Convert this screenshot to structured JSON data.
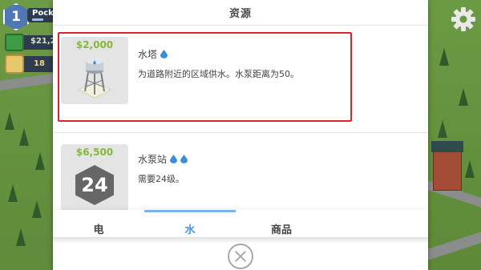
{
  "hud": {
    "level": "1",
    "player_name": "Pocke",
    "money": "$21,2",
    "goods": "18"
  },
  "modal": {
    "title": "资源",
    "items": [
      {
        "price": "$2,000",
        "name": "水塔",
        "desc": "为道路附近的区域供水。水泵距离为50。",
        "icon": "water-tower-icon",
        "drops": 1
      },
      {
        "price": "$6,500",
        "name": "水泵站",
        "desc": "需要24级。",
        "required_level": "24",
        "drops": 2
      }
    ],
    "tabs": [
      {
        "label": "电",
        "active": false
      },
      {
        "label": "水",
        "active": true
      },
      {
        "label": "商品",
        "active": false
      }
    ]
  },
  "colors": {
    "price": "#86b83a",
    "active_tab": "#4a8fe0",
    "highlight": "#d9262c",
    "water_drop": "#3a8fd8"
  }
}
